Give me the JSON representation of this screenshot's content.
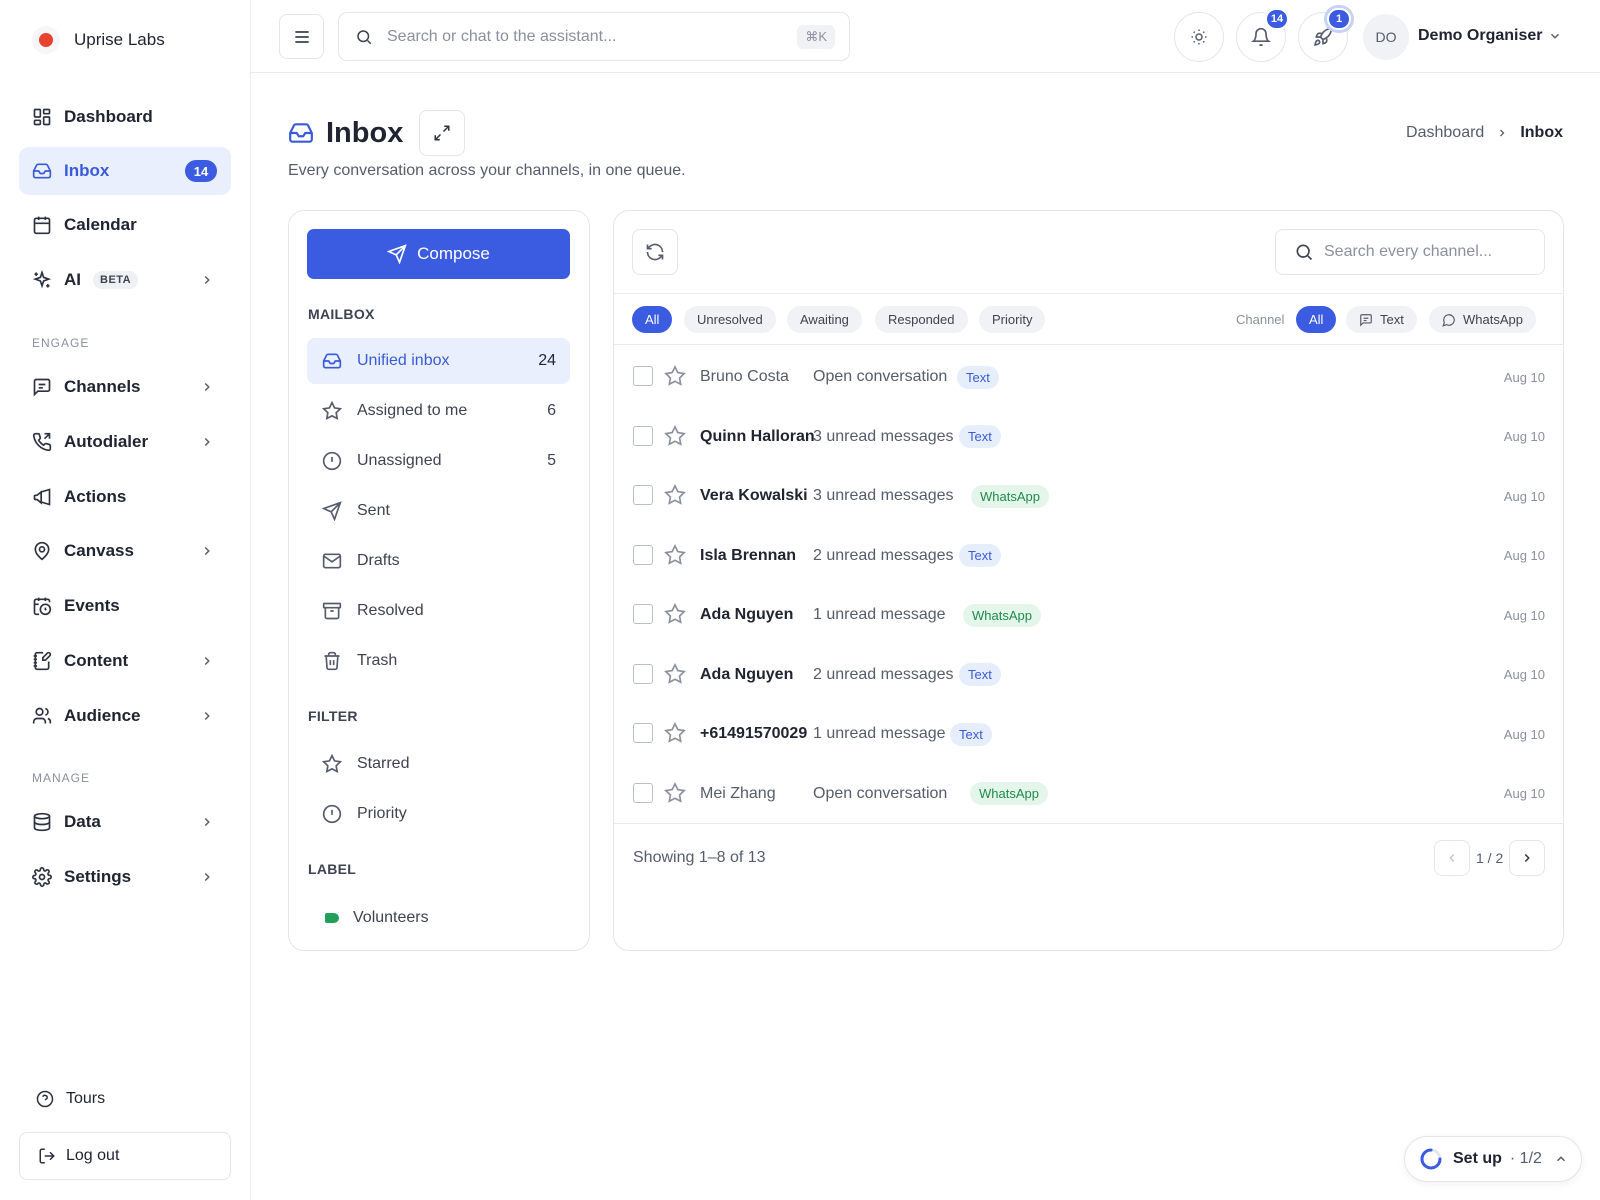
{
  "brand": {
    "name": "Uprise Labs"
  },
  "sidebar": {
    "items": [
      {
        "label": "Dashboard"
      },
      {
        "label": "Inbox",
        "badge": "14"
      },
      {
        "label": "Calendar"
      },
      {
        "label": "AI",
        "tag": "BETA"
      }
    ],
    "sections": [
      {
        "label": "ENGAGE",
        "items": [
          {
            "label": "Channels"
          },
          {
            "label": "Autodialer"
          },
          {
            "label": "Actions"
          },
          {
            "label": "Canvass"
          },
          {
            "label": "Events"
          },
          {
            "label": "Content"
          },
          {
            "label": "Audience"
          }
        ]
      },
      {
        "label": "MANAGE",
        "items": [
          {
            "label": "Data"
          },
          {
            "label": "Settings"
          }
        ]
      }
    ],
    "tours": "Tours",
    "logout": "Log out"
  },
  "topbar": {
    "search_placeholder": "Search or chat to the assistant...",
    "shortcut": "⌘K",
    "notifications_count": "14",
    "launch_count": "1",
    "user_initials": "DO",
    "user_name": "Demo Organiser"
  },
  "page": {
    "title": "Inbox",
    "subtitle": "Every conversation across your channels, in one queue.",
    "breadcrumb": [
      "Dashboard",
      "Inbox"
    ]
  },
  "mailbox": {
    "compose_label": "Compose",
    "section_mailbox": "MAILBOX",
    "items": [
      {
        "label": "Unified inbox",
        "count": "24"
      },
      {
        "label": "Assigned to me",
        "count": "6"
      },
      {
        "label": "Unassigned",
        "count": "5"
      },
      {
        "label": "Sent"
      },
      {
        "label": "Drafts"
      },
      {
        "label": "Resolved"
      },
      {
        "label": "Trash"
      }
    ],
    "section_filter": "FILTER",
    "filters": [
      {
        "label": "Starred"
      },
      {
        "label": "Priority"
      }
    ],
    "section_label": "LABEL",
    "labels": [
      {
        "label": "Volunteers",
        "color": "#22a05a"
      }
    ]
  },
  "conversations": {
    "search_placeholder": "Search every channel...",
    "status_filters": [
      "All",
      "Unresolved",
      "Awaiting",
      "Responded",
      "Priority"
    ],
    "channel_label": "Channel",
    "channel_filters": [
      "All",
      "Text",
      "WhatsApp"
    ],
    "rows": [
      {
        "name": "Bruno Costa",
        "preview": "Open conversation",
        "channel": "Text",
        "date": "Aug 10"
      },
      {
        "name": "Quinn Halloran",
        "preview": "3 unread messages",
        "channel": "Text",
        "date": "Aug 10"
      },
      {
        "name": "Vera Kowalski",
        "preview": "3 unread messages",
        "channel": "WhatsApp",
        "date": "Aug 10"
      },
      {
        "name": "Isla Brennan",
        "preview": "2 unread messages",
        "channel": "Text",
        "date": "Aug 10"
      },
      {
        "name": "Ada Nguyen",
        "preview": "1 unread message",
        "channel": "WhatsApp",
        "date": "Aug 10"
      },
      {
        "name": "Ada Nguyen",
        "preview": "2 unread messages",
        "channel": "Text",
        "date": "Aug 10"
      },
      {
        "name": "+61491570029",
        "preview": "1 unread message",
        "channel": "Text",
        "date": "Aug 10"
      },
      {
        "name": "Mei Zhang",
        "preview": "Open conversation",
        "channel": "WhatsApp",
        "date": "Aug 10"
      }
    ],
    "showing": "Showing 1–8 of 13",
    "page_indicator": "1 / 2"
  },
  "setup": {
    "label": "Set up",
    "progress": "· 1/2"
  },
  "colors": {
    "accent": "#3b5be0",
    "active_bg": "#e9effc",
    "whatsapp": "#1f8a4c",
    "brand_dot": "#e8432f"
  },
  "icons": [
    "dashboard-icon",
    "inbox-icon",
    "calendar-icon",
    "sparkle-icon",
    "chat-icon",
    "phone-icon",
    "megaphone-icon",
    "map-pin-icon",
    "calendar-clock-icon",
    "edit-icon",
    "users-icon",
    "database-icon",
    "gear-icon",
    "help-icon",
    "logout-icon",
    "menu-icon",
    "search-icon",
    "sun-icon",
    "bell-icon",
    "rocket-icon",
    "expand-icon",
    "send-icon",
    "star-icon",
    "alert-circle-icon",
    "mail-icon",
    "archive-icon",
    "trash-icon",
    "refresh-icon",
    "whatsapp-icon",
    "chevron-right-icon",
    "chevron-left-icon",
    "chevron-down-icon",
    "chevron-up-icon"
  ]
}
